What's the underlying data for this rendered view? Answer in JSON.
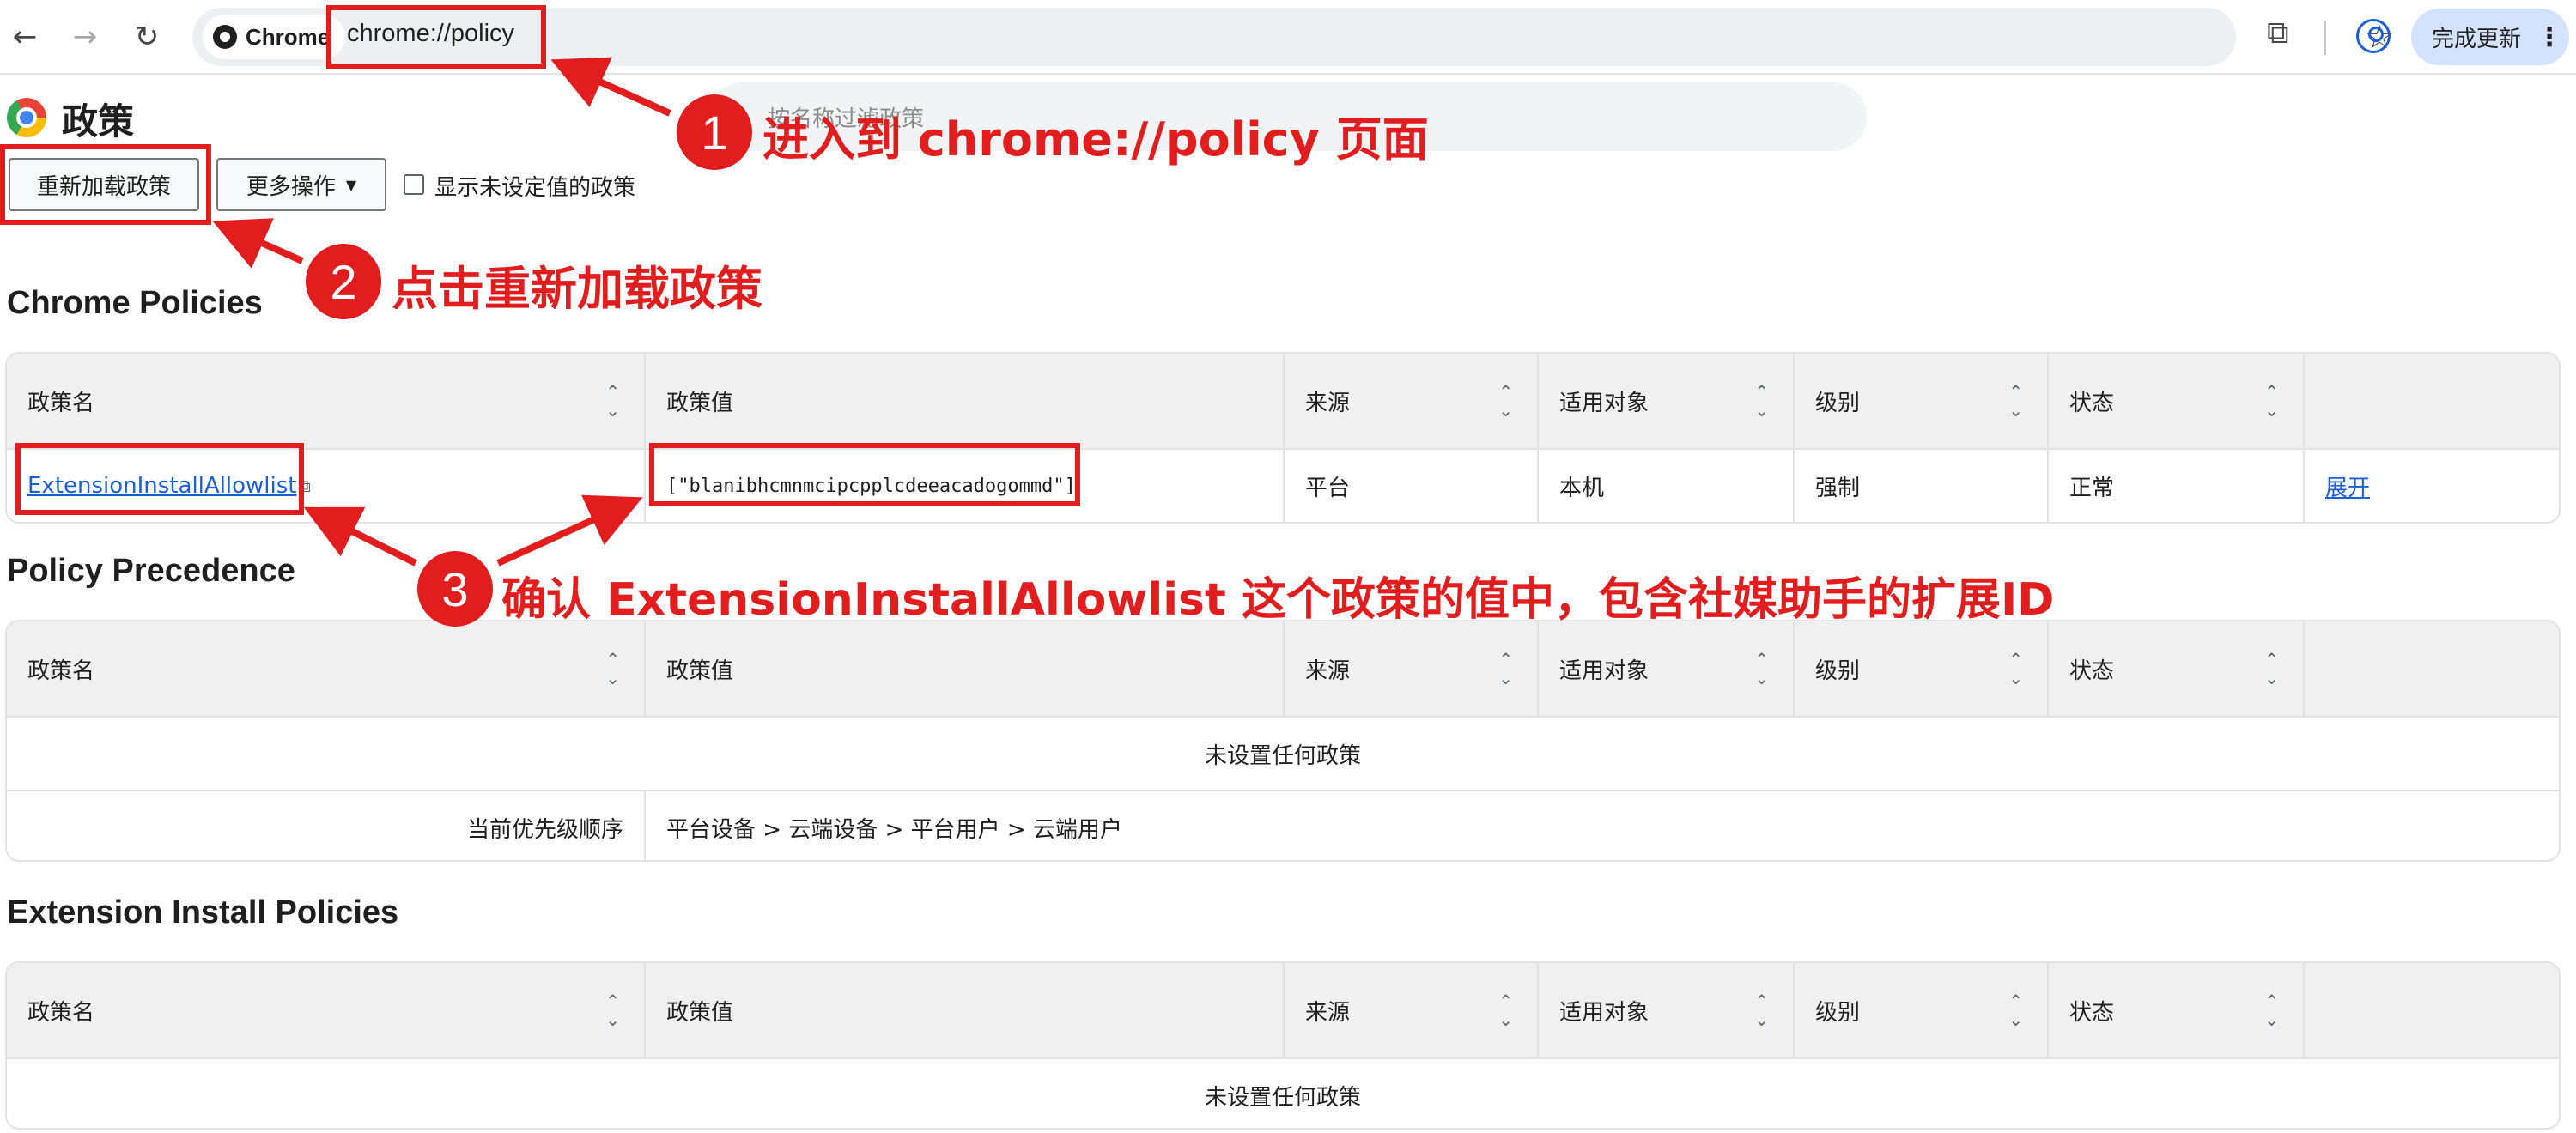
{
  "browser": {
    "chip_label": "Chrome",
    "url": "chrome://policy",
    "update_label": "完成更新",
    "icons": [
      "back-icon",
      "forward-icon",
      "reload-icon",
      "star-icon",
      "extensions-icon",
      "profile-icon",
      "kebab-menu-icon"
    ]
  },
  "page": {
    "title": "政策",
    "filter_placeholder": "按名称过滤政策",
    "reload_button": "重新加载政策",
    "more_actions_button": "更多操作",
    "show_unset_label": "显示未设定值的政策"
  },
  "columns": [
    "政策名",
    "政策值",
    "来源",
    "适用对象",
    "级别",
    "状态"
  ],
  "sections": {
    "chrome_policies": {
      "title": "Chrome Policies",
      "row": {
        "name": "ExtensionInstallAllowlist",
        "value": "[\"blanibhcmnmcipcpplcdeeacadogommd\"]",
        "source": "平台",
        "scope": "本机",
        "level": "强制",
        "status": "正常",
        "action": "展开"
      }
    },
    "policy_precedence": {
      "title": "Policy Precedence",
      "empty_text": "未设置任何政策",
      "order_label": "当前优先级顺序",
      "order_value": "平台设备 > 云端设备 > 平台用户 > 云端用户"
    },
    "extension_install": {
      "title": "Extension Install Policies",
      "empty_text": "未设置任何政策"
    }
  },
  "annotations": {
    "step1_num": "1",
    "step1_text": "进入到 chrome://policy 页面",
    "step2_num": "2",
    "step2_text": "点击重新加载政策",
    "step3_num": "3",
    "step3_text": "确认 ExtensionInstallAllowlist 这个政策的值中，包含社媒助手的扩展ID",
    "color": "#e11d1d"
  }
}
